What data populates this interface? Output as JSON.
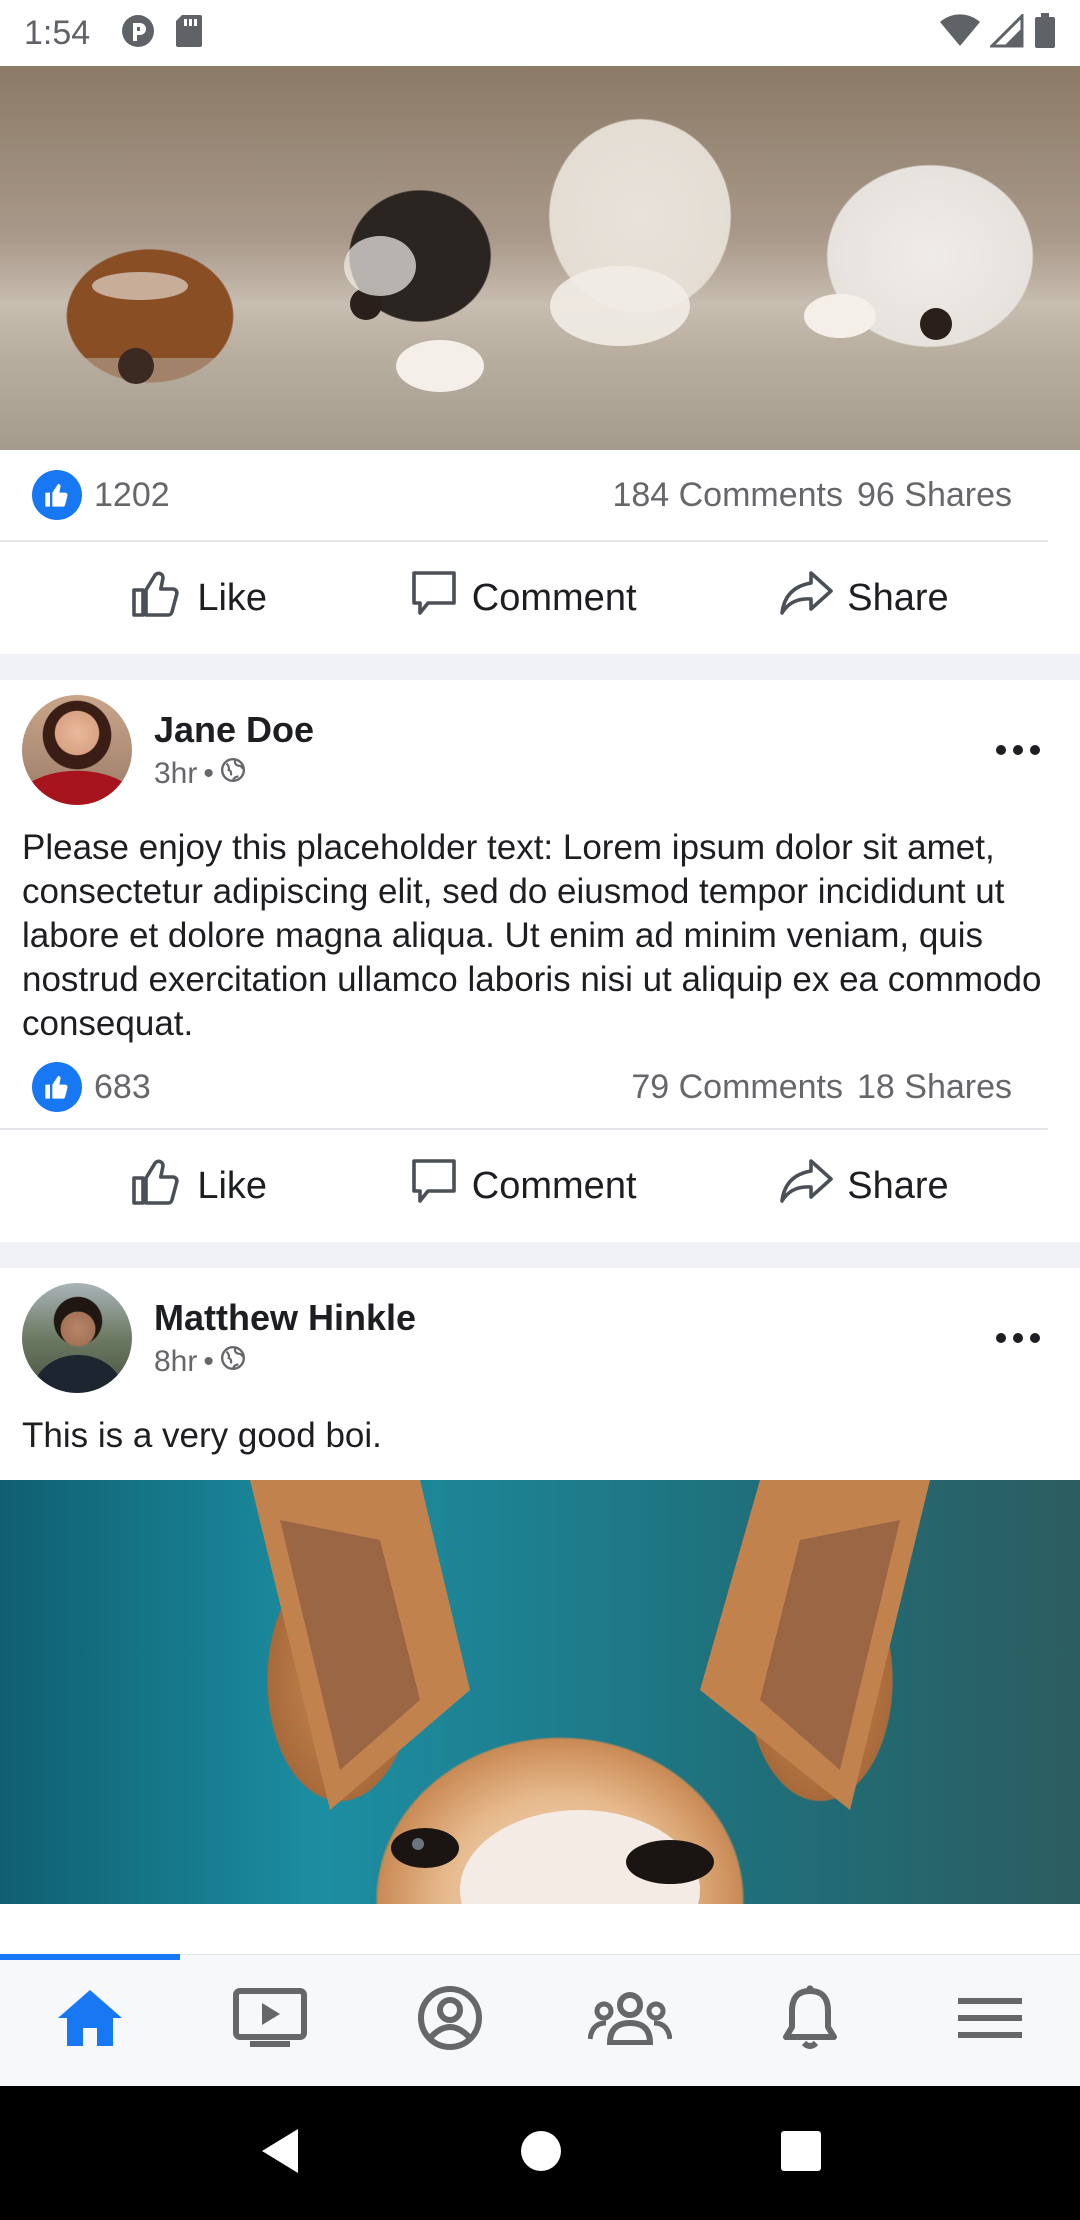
{
  "status_bar": {
    "time": "1:54",
    "icons": [
      "app-notification-icon",
      "sd-card-icon",
      "wifi-icon",
      "cell-signal-icon",
      "battery-icon"
    ]
  },
  "posts": [
    {
      "id": "post-1",
      "photo": "puppies-photo",
      "likes": "1202",
      "comments": "184 Comments",
      "shares": "96 Shares"
    },
    {
      "id": "post-2",
      "author": "Jane Doe",
      "time": "3hr",
      "dot": "•",
      "text": "Please enjoy this placeholder text: Lorem ipsum dolor sit amet, consectetur adipiscing elit, sed do eiusmod tempor incididunt ut labore et dolore magna aliqua. Ut enim ad minim veniam, quis nostrud exercitation ullamco laboris nisi ut aliquip ex ea commodo consequat.",
      "likes": "683",
      "comments": "79 Comments",
      "shares": "18 Shares"
    },
    {
      "id": "post-3",
      "author": "Matthew Hinkle",
      "time": "8hr",
      "dot": "•",
      "text": "This is a very good boi.",
      "photo": "shiba-dog-photo"
    }
  ],
  "actions": {
    "like": "Like",
    "comment": "Comment",
    "share": "Share"
  },
  "bottom_nav": {
    "items": [
      "home-icon",
      "watch-icon",
      "profile-icon",
      "groups-icon",
      "notifications-icon",
      "menu-icon"
    ],
    "active": "home-icon"
  },
  "colors": {
    "accent": "#1877f2",
    "text_primary": "#1c1e21",
    "text_secondary": "#65676b",
    "separator": "#f0f2f5"
  }
}
